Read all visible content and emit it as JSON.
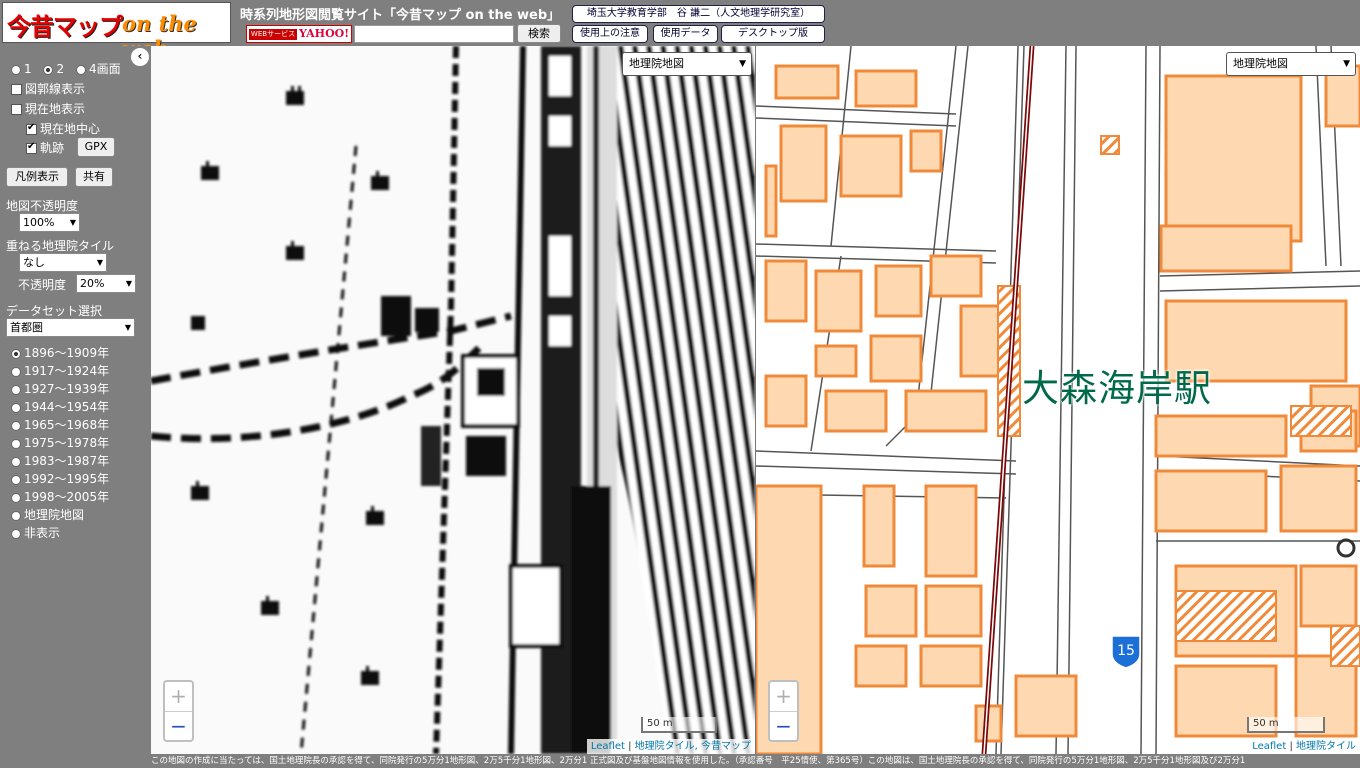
{
  "header": {
    "logo_main": "今昔マップ",
    "logo_sub": "on the web",
    "site_title": "時系列地形図閲覧サイト「今昔マップ on the web」",
    "webservice_badge": "WEBサービス",
    "yahoo_badge": "YAHOO!",
    "search_value": "",
    "search_button": "検索",
    "credit": "埼玉大学教育学部　谷 謙二（人文地理学研究室）",
    "usage_notes": "使用上の注意",
    "data_used": "使用データ",
    "desktop_version": "デスクトップ版"
  },
  "sidebar": {
    "view_modes": [
      {
        "label": "1",
        "selected": false
      },
      {
        "label": "2",
        "selected": true
      },
      {
        "label": "4画面",
        "selected": false
      }
    ],
    "grid_lines": {
      "label": "図郭線表示",
      "checked": false
    },
    "current_location": {
      "label": "現在地表示",
      "checked": false
    },
    "center_on_location": {
      "label": "現在地中心",
      "checked": true
    },
    "track": {
      "label": "軌跡",
      "checked": true
    },
    "gpx_button": "GPX",
    "legend_button": "凡例表示",
    "share_button": "共有",
    "opacity_label": "地図不透明度",
    "opacity_value": "100%",
    "overlay_label": "重ねる地理院タイル",
    "overlay_value": "なし",
    "overlay_opacity_label": "不透明度",
    "overlay_opacity_value": "20%",
    "dataset_label": "データセット選択",
    "dataset_value": "首都圏",
    "periods": [
      {
        "label": "1896～1909年",
        "selected": true
      },
      {
        "label": "1917～1924年",
        "selected": false
      },
      {
        "label": "1927～1939年",
        "selected": false
      },
      {
        "label": "1944～1954年",
        "selected": false
      },
      {
        "label": "1965～1968年",
        "selected": false
      },
      {
        "label": "1975～1978年",
        "selected": false
      },
      {
        "label": "1983～1987年",
        "selected": false
      },
      {
        "label": "1992～1995年",
        "selected": false
      },
      {
        "label": "1998～2005年",
        "selected": false
      },
      {
        "label": "地理院地図",
        "selected": false
      },
      {
        "label": "非表示",
        "selected": false
      }
    ],
    "collapse_glyph": "‹"
  },
  "map_left": {
    "layer": "地理院地図",
    "zoom_in": "+",
    "zoom_out": "−",
    "scale": "50 m",
    "attribution_leaflet": "Leaflet",
    "attribution_sep": " | ",
    "attribution_rest": "地理院タイル, 今昔マップ"
  },
  "map_right": {
    "layer": "地理院地図",
    "zoom_in": "+",
    "zoom_out": "−",
    "scale": "50 m",
    "attribution_leaflet": "Leaflet",
    "attribution_sep": " | ",
    "attribution_rest": "地理院タイル",
    "station_name": "大森海岸駅",
    "route_number": "15"
  },
  "footer_notice": "この地図の作成に当たっては、国土地理院長の承認を得て、同院発行の5万分1地形図、2万5千分1地形図、2万分1 正式図及び基盤地図情報を使用した。（承認番号　平25情使、第365号）この地図は、国土地理院長の承認を得て、同院発行の5万分1地形図、2万5千分1地形図及び2万分1",
  "colors": {
    "sidebar_bg": "#7f7f7f",
    "building_fill": "#fdd8b0",
    "building_stroke": "#f08a3a",
    "rail": "#7a0a0a",
    "station_text": "#00694a"
  }
}
